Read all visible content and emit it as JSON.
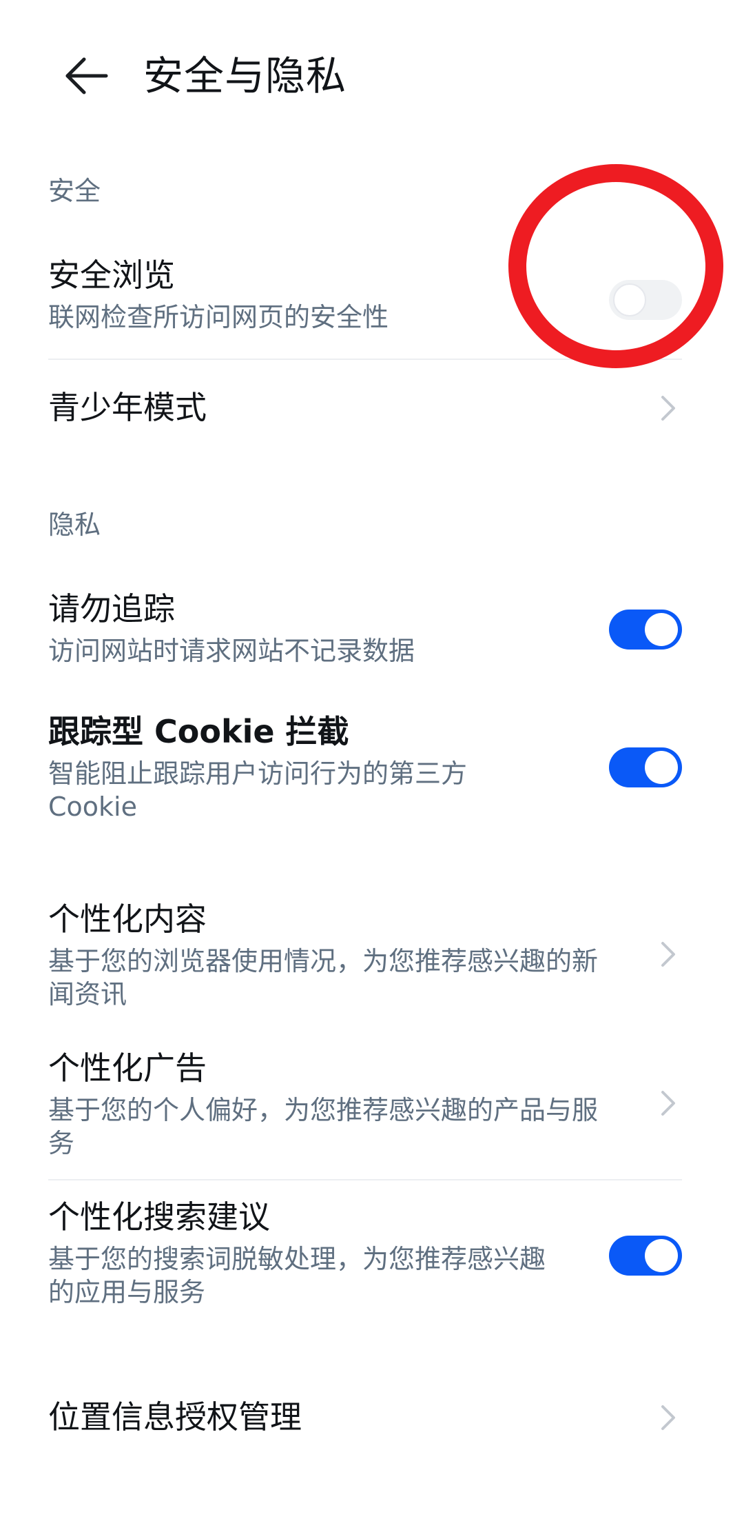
{
  "header": {
    "title": "安全与隐私",
    "back_icon": "arrow-left-icon"
  },
  "sections": {
    "security_label": "安全",
    "privacy_label": "隐私"
  },
  "items": {
    "safe_browsing": {
      "title": "安全浏览",
      "subtitle": "联网检查所访问网页的安全性",
      "toggle": false
    },
    "teen_mode": {
      "title": "青少年模式"
    },
    "do_not_track": {
      "title": "请勿追踪",
      "subtitle": "访问网站时请求网站不记录数据",
      "toggle": true
    },
    "tracking_cookie": {
      "title": "跟踪型 Cookie 拦截",
      "subtitle": "智能阻止跟踪用户访问行为的第三方",
      "subtitle2": "Cookie",
      "toggle": true
    },
    "personalized_content": {
      "title": "个性化内容",
      "subtitle": "基于您的浏览器使用情况，为您推荐感兴趣的新",
      "subtitle2": "闻资讯"
    },
    "personalized_ads": {
      "title": "个性化广告",
      "subtitle": "基于您的个人偏好，为您推荐感兴趣的产品与服",
      "subtitle2": "务"
    },
    "personalized_search": {
      "title": "个性化搜索建议",
      "subtitle": "基于您的搜索词脱敏处理，为您推荐感兴趣",
      "subtitle2": "的应用与服务",
      "toggle": true
    },
    "location_auth": {
      "title": "位置信息授权管理"
    }
  },
  "colors": {
    "accent": "#0a59f7",
    "annotation": "#ee1c22",
    "secondary_text": "#5f6f80"
  }
}
